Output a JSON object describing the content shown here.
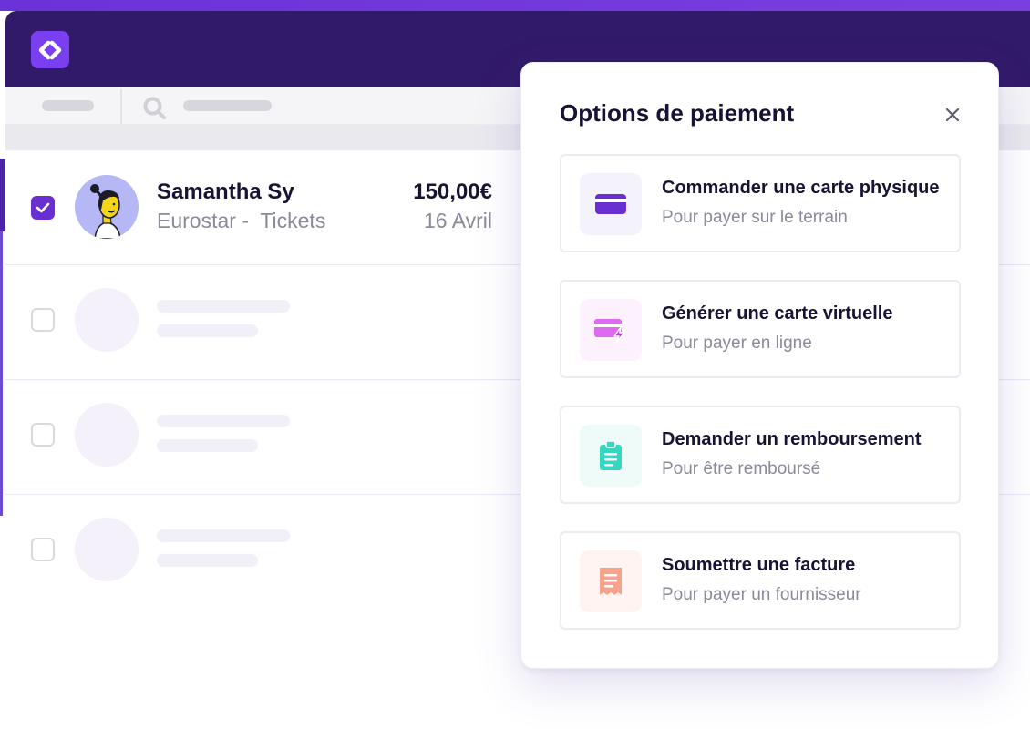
{
  "colors": {
    "brand": "#7b3ff2",
    "header": "#321a6a",
    "checkbox_checked": "#6a2fd0"
  },
  "list": {
    "rows": [
      {
        "selected": true,
        "name": "Samantha Sy",
        "description": "Eurostar -  Tickets",
        "amount": "150,00€",
        "date": "16 Avril"
      },
      {
        "selected": false
      },
      {
        "selected": false
      },
      {
        "selected": false
      }
    ]
  },
  "modal": {
    "title": "Options de paiement",
    "close_icon": "close-icon",
    "options": [
      {
        "title": "Commander une carte physique",
        "subtitle": "Pour payer sur le terrain",
        "icon": "card-icon",
        "color": "#6a2fd0"
      },
      {
        "title": "Générer une carte virtuelle",
        "subtitle": "Pour payer en ligne",
        "icon": "virtual-card-icon",
        "color": "#dd6af0"
      },
      {
        "title": "Demander un remboursement",
        "subtitle": "Pour être remboursé",
        "icon": "clipboard-icon",
        "color": "#37d6c0"
      },
      {
        "title": "Soumettre une facture",
        "subtitle": "Pour payer un fournisseur",
        "icon": "receipt-icon",
        "color": "#f8a38a"
      }
    ]
  }
}
